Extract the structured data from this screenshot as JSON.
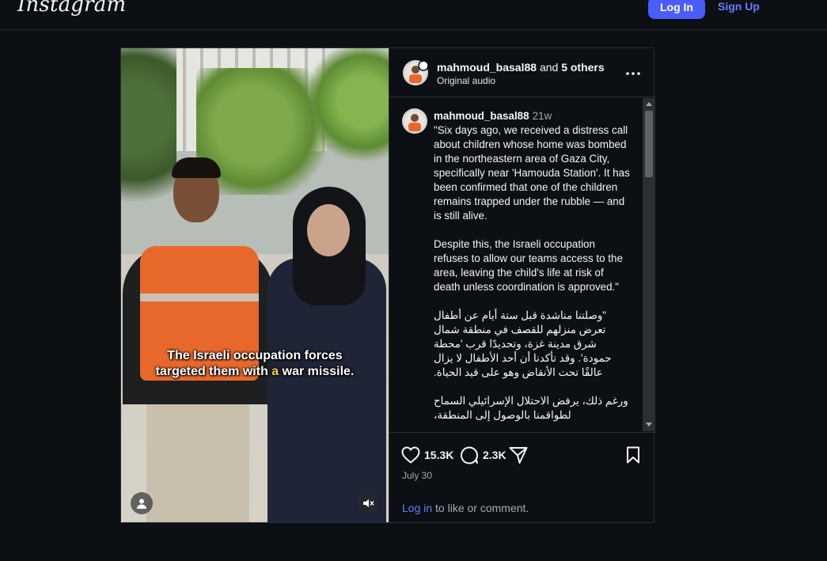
{
  "topbar": {
    "logo": "Instagram",
    "login_button": "Log In",
    "signup_link": "Sign Up"
  },
  "media": {
    "caption_line1": "The Israeli occupation forces",
    "caption_line2_a": "targeted them with ",
    "caption_line2_hl": "a",
    "caption_line2_b": " war missile.",
    "highlight_color": "#f3d23a"
  },
  "header": {
    "username": "mahmoud_basal88",
    "and_text": " and ",
    "others": "5 others",
    "audio": "Original audio"
  },
  "comment": {
    "username": "mahmoud_basal88",
    "time": "21w",
    "para1": "\"Six days ago, we received a distress call about children whose home was bombed in the northeastern area of Gaza City, specifically near 'Hamouda Station'. It has been confirmed that one of the children remains trapped under the rubble — and is still alive.",
    "para2": "Despite this, the Israeli occupation refuses to allow our teams access to the area, leaving the child's life at risk of death unless coordination is approved.\"",
    "para3": "\"وصلتنا مناشدة قبل ستة أيام عن أطفال تعرض منزلهم للقصف في منطقة شمال شرق مدينة غزة، وتحديدًا قرب 'محطة حمودة'. وقد تأكدنا أن أحد الأطفال لا يزال عالقًا تحت الأنقاض وهو على قيد الحياة.",
    "para4": "ورغم ذلك، يرفض الاحتلال الإسرائيلي السماح لطواقمنا بالوصول إلى المنطقة،"
  },
  "actions": {
    "likes": "15.3K",
    "comments": "2.3K",
    "date": "July 30",
    "login_link": "Log in",
    "login_suffix": " to like or comment."
  },
  "colors": {
    "accent": "#4a5df9",
    "link": "#6b7cff",
    "background": "#0c0f14"
  }
}
